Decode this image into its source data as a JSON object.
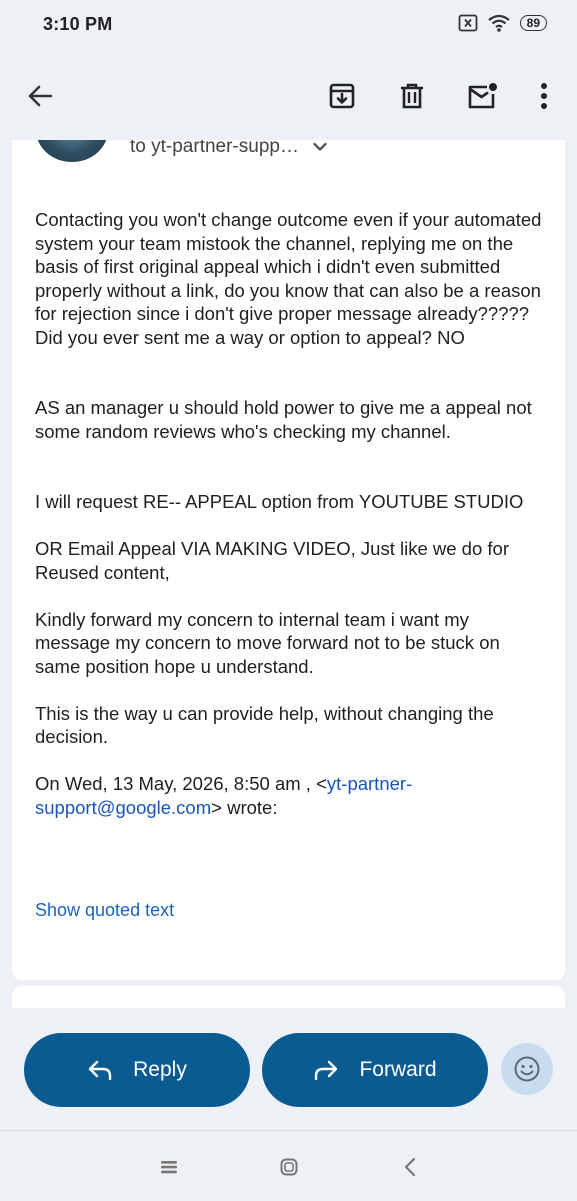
{
  "status_bar": {
    "time": "3:10 PM",
    "battery": "89"
  },
  "toolbar": {
    "back_icon": "back-arrow-icon",
    "archive_icon": "archive-icon",
    "delete_icon": "trash-icon",
    "mark_unread_icon": "mark-unread-icon",
    "more_icon": "more-vert-icon"
  },
  "message": {
    "recipient": "to yt-partner-supp…",
    "paragraphs": [
      "Contacting you won't change outcome even if your automated system your team mistook the channel, replying me on the basis of first original appeal which i didn't even submitted properly without a link, do you know that can also be a reason for rejection since i don't give proper message already????? Did you ever sent me a way or option to appeal? NO",
      "AS an manager u should hold power to give me a appeal not some random reviews who's checking my channel.",
      "I will request RE-- APPEAL option from YOUTUBE STUDIO",
      "OR Email Appeal VIA MAKING VIDEO, Just like we do for Reused content,",
      "Kindly forward my concern to internal team i want my message my concern to move forward not to be stuck on same position hope u understand.",
      "This is the way u can provide help, without changing the decision."
    ],
    "quote_prefix": "On Wed, 13 May, 2026, 8:50 am , <",
    "quote_email": "yt-partner-support@google.com",
    "quote_suffix": "> wrote:",
    "show_quoted": "Show quoted text"
  },
  "actions": {
    "reply_label": "Reply",
    "forward_label": "Forward"
  },
  "colors": {
    "accent": "#0b5b93",
    "link": "#1a63c0",
    "background": "#edf0f5"
  }
}
